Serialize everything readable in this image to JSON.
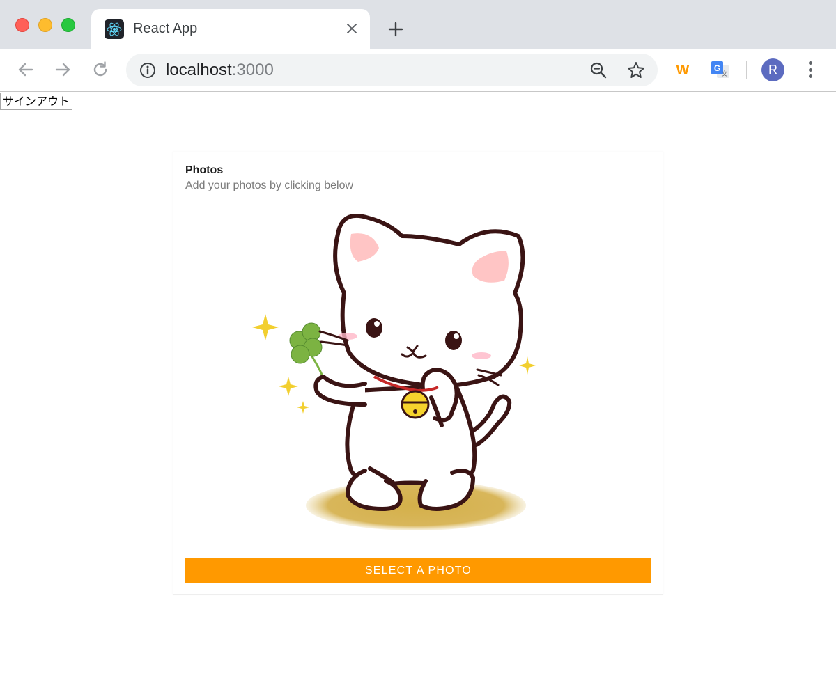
{
  "window": {
    "tab": {
      "title": "React App",
      "favicon": "react-logo-icon"
    },
    "address_bar": {
      "host": "localhost",
      "port": ":3000"
    },
    "extensions": {
      "w_label": "W"
    },
    "profile": {
      "initial": "R"
    }
  },
  "page": {
    "signout_label": "サインアウト",
    "card": {
      "title": "Photos",
      "subtitle": "Add your photos by clicking below",
      "image": "white-cat-with-clover-illustration",
      "button_label": "Select a photo"
    }
  },
  "colors": {
    "accent": "#ff9900",
    "avatar": "#5c6bc0",
    "tabstrip": "#dee1e6"
  }
}
